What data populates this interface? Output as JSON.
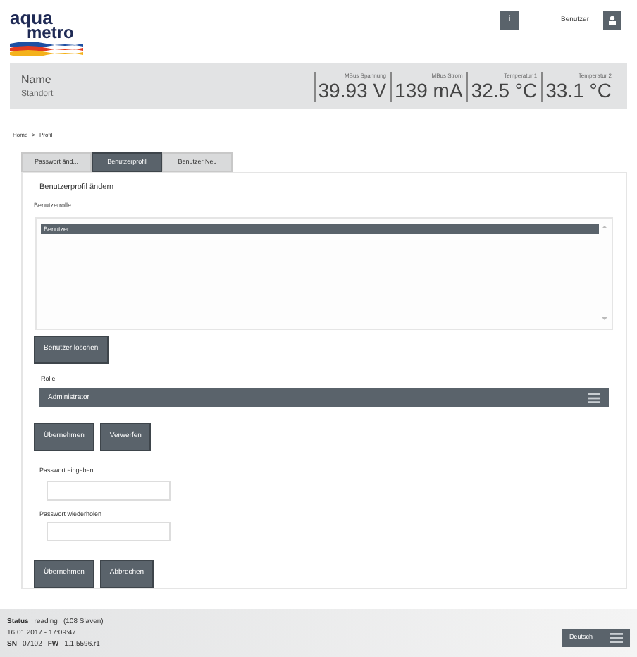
{
  "header": {
    "logo_top": "aqua",
    "logo_bottom": "metro",
    "info_button": "i",
    "user_label": "Benutzer"
  },
  "device": {
    "name": "Name",
    "location": "Standort"
  },
  "measurements": [
    {
      "label": "MBus Spannung",
      "value": "39.93 V"
    },
    {
      "label": "MBus Strom",
      "value": "139 mA"
    },
    {
      "label": "Temperatur 1",
      "value": "32.5 °C"
    },
    {
      "label": "Temperatur 2",
      "value": "33.1 °C"
    }
  ],
  "breadcrumb": [
    "Home",
    ">",
    "Profil"
  ],
  "tabs": [
    {
      "label": "Passwort änd...",
      "selected": false
    },
    {
      "label": "Benutzerprofil",
      "selected": true
    },
    {
      "label": "Benutzer Neu",
      "selected": false
    }
  ],
  "form": {
    "title": "Benutzerprofil ändern",
    "list_label": "Benutzerrolle",
    "list_items": [
      {
        "label": "Benutzer",
        "selected": true
      }
    ],
    "delete_button": "Benutzer löschen",
    "role_label": "Rolle",
    "role_value": "Administrator",
    "role_buttons": [
      "Übernehmen",
      "Verwerfen"
    ],
    "password_label": "Passwort eingeben",
    "repeat_label": "Passwort wiederholen",
    "password_buttons": [
      "Übernehmen",
      "Abbrechen"
    ]
  },
  "status_bar": {
    "status_label": "Status",
    "status_value": "reading",
    "status_detail": "(108 Slaven)",
    "datetime": "16.01.2017 - 17:09:47",
    "sn_label": "SN",
    "sn_value": "07102",
    "fw_label": "FW",
    "fw_value": "1.1.5596.r1",
    "language": "Deutsch"
  }
}
